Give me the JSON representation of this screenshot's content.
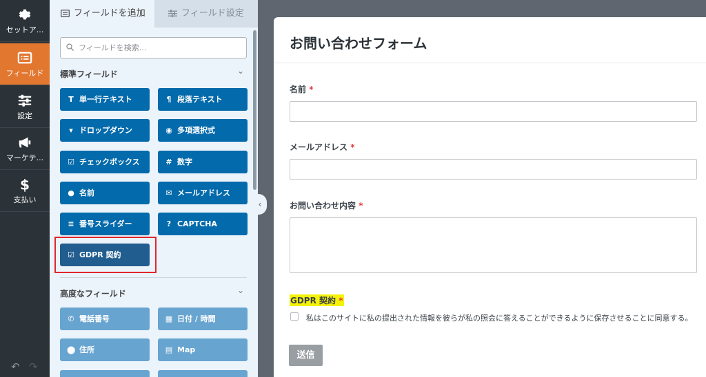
{
  "rail": {
    "items": [
      {
        "label": "セットア...",
        "icon": "gear-icon"
      },
      {
        "label": "フィールド",
        "icon": "fields-icon",
        "active": true
      },
      {
        "label": "設定",
        "icon": "sliders-icon"
      },
      {
        "label": "マーケテ...",
        "icon": "megaphone-icon"
      },
      {
        "label": "支払い",
        "icon": "dollar-icon"
      }
    ],
    "undo": "↶",
    "redo": "↷"
  },
  "panel": {
    "tab_add": "フィールドを追加",
    "tab_options": "フィールド設定",
    "search_placeholder": "フィールドを検索...",
    "standard_title": "標準フィールド",
    "standard_fields": [
      {
        "label": "単一行テキスト",
        "icon": "text-icon",
        "glyph": "T"
      },
      {
        "label": "段落テキスト",
        "icon": "paragraph-icon",
        "glyph": "¶"
      },
      {
        "label": "ドロップダウン",
        "icon": "dropdown-icon",
        "glyph": "▾"
      },
      {
        "label": "多項選択式",
        "icon": "radio-icon",
        "glyph": "◉"
      },
      {
        "label": "チェックボックス",
        "icon": "checkbox-icon",
        "glyph": "☑"
      },
      {
        "label": "数字",
        "icon": "hash-icon",
        "glyph": "#"
      },
      {
        "label": "名前",
        "icon": "user-icon",
        "glyph": "●"
      },
      {
        "label": "メールアドレス",
        "icon": "envelope-icon",
        "glyph": "✉"
      },
      {
        "label": "番号スライダー",
        "icon": "sliders-icon",
        "glyph": "≡"
      },
      {
        "label": "CAPTCHA",
        "icon": "question-icon",
        "glyph": "?"
      },
      {
        "label": "GDPR 契約",
        "icon": "checkbox-icon",
        "glyph": "☑",
        "selected": true
      }
    ],
    "advanced_title": "高度なフィールド",
    "advanced_fields": [
      {
        "label": "電話番号",
        "icon": "phone-icon",
        "glyph": "✆"
      },
      {
        "label": "日付 / 時間",
        "icon": "calendar-icon",
        "glyph": "▦"
      },
      {
        "label": "住所",
        "icon": "map-pin-icon",
        "glyph": "⬤"
      },
      {
        "label": "Map",
        "icon": "map-icon",
        "glyph": "▤"
      }
    ],
    "collapse_glyph": "‹",
    "chevron": "⌄"
  },
  "form": {
    "title": "お問い合わせフォーム",
    "fields": [
      {
        "label": "名前",
        "required": "*"
      },
      {
        "label": "メールアドレス",
        "required": "*"
      },
      {
        "label": "お問い合わせ内容",
        "required": "*"
      }
    ],
    "gdpr_label": "GDPR 契約",
    "gdpr_required": "*",
    "gdpr_text": "私はこのサイトに私の提出された情報を彼らが私の照会に答えることができるように保存させることに同意する。",
    "submit": "送信"
  },
  "colors": {
    "accent": "#e27730",
    "button_blue": "#036aab",
    "highlight_red": "#e0262d",
    "gdpr_highlight": "#f5f20a"
  }
}
